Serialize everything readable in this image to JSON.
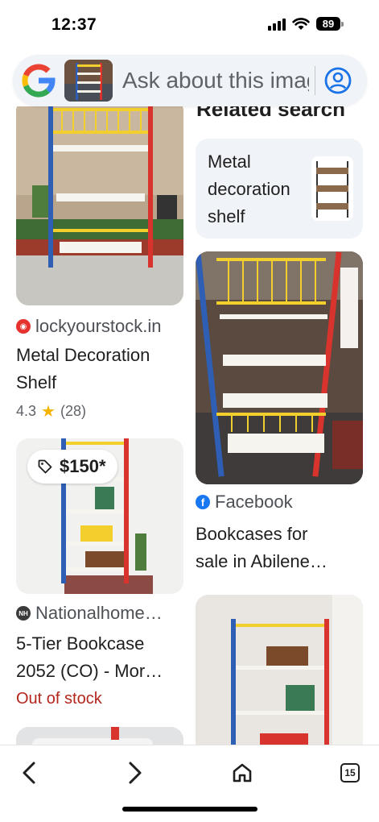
{
  "status_bar": {
    "time": "12:37",
    "battery": "89"
  },
  "search": {
    "placeholder": "Ask about this image",
    "value": ""
  },
  "related": {
    "heading": "Related search",
    "chip_label": "Metal decoration shelf"
  },
  "results": [
    {
      "source": "lockyourstock.in",
      "title_line1": "Metal Decoration",
      "title_line2": "Shelf",
      "rating": "4.3",
      "reviews": "(28)"
    },
    {
      "price": "$150*",
      "source": "Nationalhome…",
      "title_line1": "5-Tier Bookcase",
      "title_line2": "2052 (CO) - Mor…",
      "availability": "Out of stock"
    },
    {
      "source": "Facebook",
      "title_line1": "Bookcases for",
      "title_line2": "sale in Abilene…"
    }
  ],
  "nav": {
    "tabs_count": "15"
  },
  "colors": {
    "frame_red": "#d8342d",
    "frame_blue": "#2f5fb5",
    "frame_yellow": "#f2cf2d",
    "google_blue": "#1a73e8",
    "out_of_stock": "#b3261e"
  },
  "icons": [
    "google-logo-icon",
    "account-circle-icon",
    "lockyourstock-favicon-icon",
    "tag-icon",
    "nationalhome-favicon-icon",
    "facebook-icon",
    "back-arrow-icon",
    "forward-arrow-icon",
    "home-icon",
    "tabs-icon"
  ]
}
